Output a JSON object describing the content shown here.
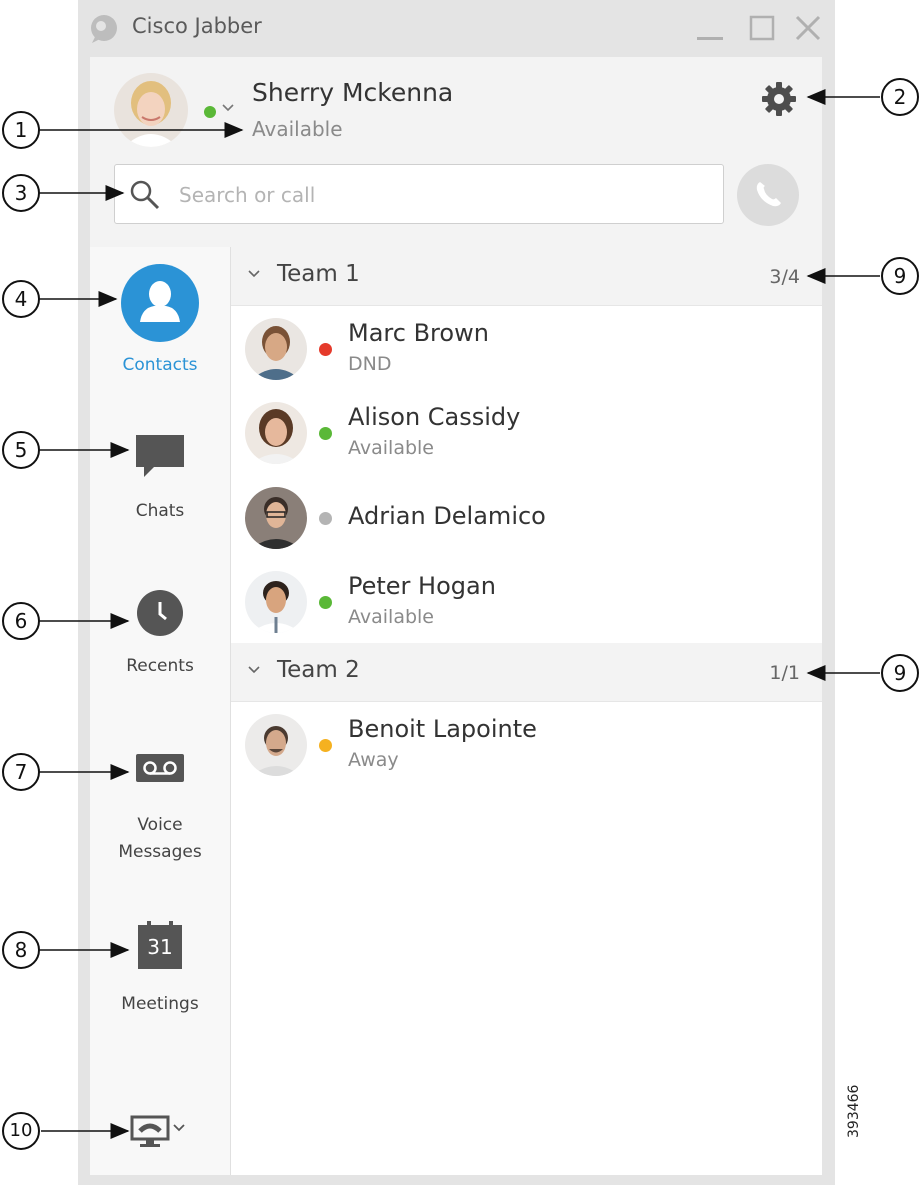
{
  "window": {
    "title": "Cisco Jabber",
    "controls": {
      "minimize_icon": "minimize-icon",
      "maximize_icon": "maximize-icon",
      "close_icon": "close-icon"
    }
  },
  "header": {
    "user_name": "Sherry Mckenna",
    "user_status": "Available",
    "status_color": "#5ab837",
    "search_placeholder": "Search or call"
  },
  "sidebar": {
    "items": [
      {
        "label": "Contacts",
        "icon": "person-icon",
        "active": true
      },
      {
        "label": "Chats",
        "icon": "chat-icon"
      },
      {
        "label": "Recents",
        "icon": "clock-icon"
      },
      {
        "label": "Voice Messages",
        "icon": "voicemail-icon"
      },
      {
        "label": "Meetings",
        "icon": "calendar-icon",
        "calendar_day": "31"
      }
    ],
    "bottom_icon": "desk-phone-icon"
  },
  "groups": [
    {
      "name": "Team 1",
      "count": "3/4",
      "contacts": [
        {
          "name": "Marc Brown",
          "status": "DND",
          "status_color": "#e53a2b"
        },
        {
          "name": "Alison Cassidy",
          "status": "Available",
          "status_color": "#5ab837"
        },
        {
          "name": "Adrian Delamico",
          "status": "",
          "status_color": "#b4b4b4"
        },
        {
          "name": "Peter Hogan",
          "status": "Available",
          "status_color": "#5ab837"
        }
      ]
    },
    {
      "name": "Team 2",
      "count": "1/1",
      "contacts": [
        {
          "name": "Benoit Lapointe",
          "status": "Away",
          "status_color": "#f5b120"
        }
      ]
    }
  ],
  "callouts": [
    "1",
    "2",
    "3",
    "4",
    "5",
    "6",
    "7",
    "8",
    "9",
    "9",
    "10"
  ],
  "figure_id": "393466",
  "colors": {
    "accent": "#2b93d6",
    "icon_dark": "#555555"
  }
}
